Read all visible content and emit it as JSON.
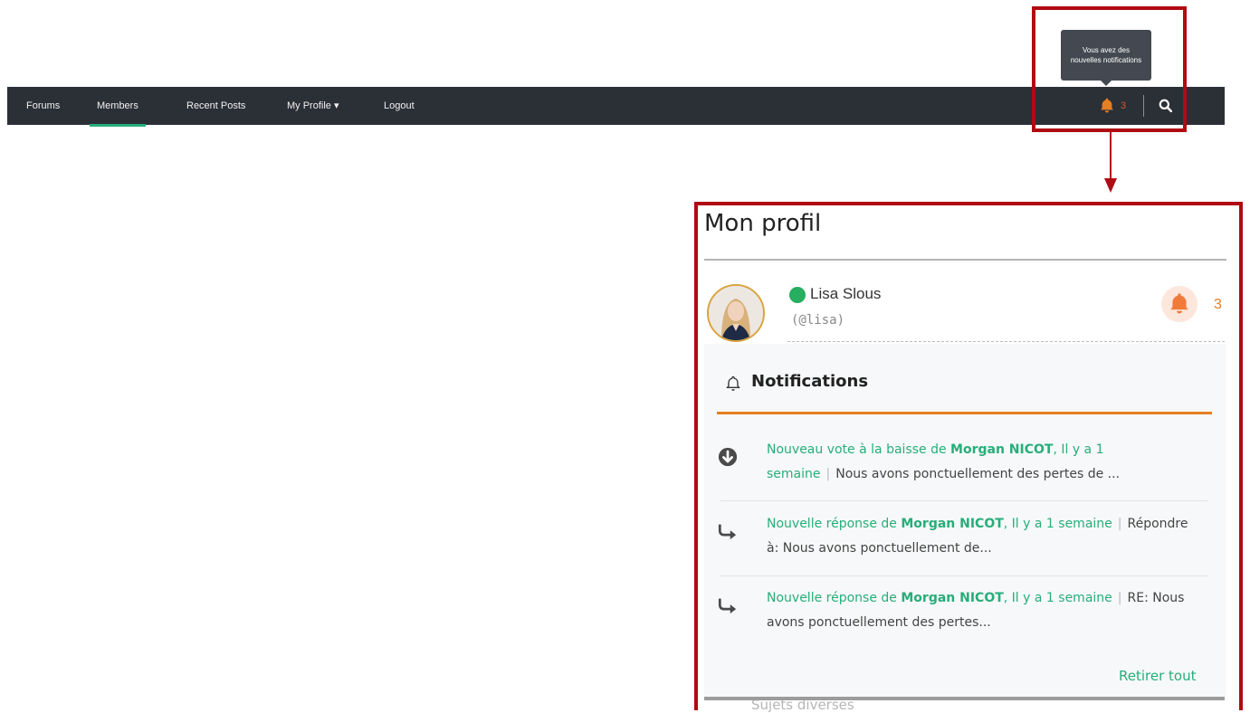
{
  "nav": {
    "items": [
      {
        "label": "Forums"
      },
      {
        "label": "Members"
      },
      {
        "label": "Recent Posts"
      },
      {
        "label": "My Profile ▾"
      },
      {
        "label": "Logout"
      }
    ],
    "active": "Members",
    "notification_count": "3",
    "icons": {
      "bell": "bell-icon",
      "search": "search-icon"
    }
  },
  "tooltip": {
    "text": "Vous avez des nouvelles notifications"
  },
  "panel": {
    "title": "Mon profil",
    "user": {
      "name": "Lisa Slous",
      "handle": "(@lisa)",
      "status": "online"
    },
    "notification_count": "3",
    "notifications_title": "Notifications",
    "items": [
      {
        "icon": "arrow-down-circle-icon",
        "prefix": "Nouveau vote à la baisse de",
        "author": "Morgan NICOT",
        "time": ", Il y a 1 semaine",
        "excerpt": "Nous avons ponctuellement des pertes de ..."
      },
      {
        "icon": "reply-arrow-icon",
        "prefix": "Nouvelle réponse de",
        "author": "Morgan NICOT",
        "time": ", Il y a 1 semaine",
        "excerpt": "Répondre à: Nous avons ponctuellement de..."
      },
      {
        "icon": "reply-arrow-icon",
        "prefix": "Nouvelle réponse de",
        "author": "Morgan NICOT",
        "time": ", Il y a 1 semaine",
        "excerpt": "RE: Nous avons ponctuellement des pertes..."
      }
    ],
    "clear_all": "Retirer tout",
    "behind_text": "Sujets diverses"
  },
  "colors": {
    "navbar": "#2b2f36",
    "accent_green": "#27ae7a",
    "accent_orange": "#e67e22",
    "highlight_red": "#b00a12"
  }
}
